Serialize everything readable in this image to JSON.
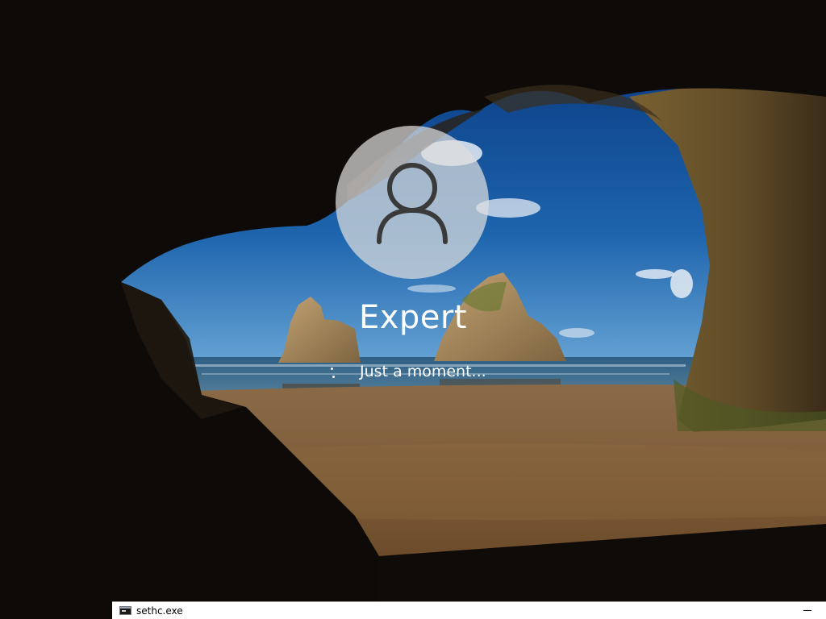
{
  "lock_screen": {
    "user_name": "Expert",
    "status_text": "Just a moment..."
  },
  "window": {
    "title": "sethc.exe",
    "icon": "console-icon",
    "minimize_icon": "minimize-icon"
  },
  "icons": {
    "avatar": "user-silhouette-icon",
    "spinner": "loading-spinner-icon"
  },
  "colors": {
    "text": "#ffffff",
    "avatar_bg": "#dedede",
    "window_bg": "#ffffff"
  }
}
